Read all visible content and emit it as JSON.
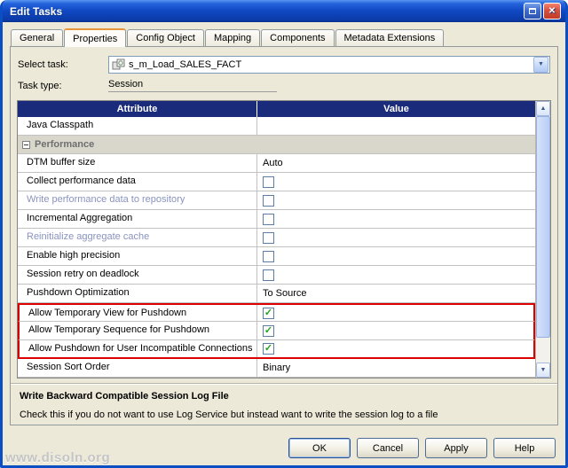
{
  "window": {
    "title": "Edit Tasks",
    "close_glyph": "✕"
  },
  "tabs": {
    "items": [
      {
        "label": "General",
        "active": false
      },
      {
        "label": "Properties",
        "active": true
      },
      {
        "label": "Config Object",
        "active": false
      },
      {
        "label": "Mapping",
        "active": false
      },
      {
        "label": "Components",
        "active": false
      },
      {
        "label": "Metadata Extensions",
        "active": false
      }
    ]
  },
  "form": {
    "select_task_label": "Select task:",
    "select_task_value": "s_m_Load_SALES_FACT",
    "task_type_label": "Task type:",
    "task_type_value": "Session"
  },
  "icons": {
    "combo_arrow": "▼",
    "scroll_up": "▲",
    "scroll_down": "▼"
  },
  "table": {
    "headers": {
      "attribute": "Attribute",
      "value": "Value"
    },
    "check_glyph": "✓",
    "rows": [
      {
        "label": "Java Classpath",
        "type": "empty"
      },
      {
        "label": "Performance",
        "type": "group"
      },
      {
        "label": "DTM buffer size",
        "type": "text",
        "value": "Auto"
      },
      {
        "label": "Collect performance data",
        "type": "checkbox",
        "checked": false
      },
      {
        "label": "Write performance data to repository",
        "type": "checkbox",
        "checked": false,
        "muted": true
      },
      {
        "label": "Incremental Aggregation",
        "type": "checkbox",
        "checked": false
      },
      {
        "label": "Reinitialize aggregate cache",
        "type": "checkbox",
        "checked": false,
        "muted": true
      },
      {
        "label": "Enable high precision",
        "type": "checkbox",
        "checked": false
      },
      {
        "label": "Session retry on deadlock",
        "type": "checkbox",
        "checked": false
      },
      {
        "label": "Pushdown Optimization",
        "type": "text",
        "value": "To Source"
      },
      {
        "label": "Allow Temporary View for Pushdown",
        "type": "checkbox",
        "checked": true,
        "highlight": "start"
      },
      {
        "label": "Allow Temporary Sequence for Pushdown",
        "type": "checkbox",
        "checked": true,
        "highlight": "mid"
      },
      {
        "label": "Allow Pushdown for User Incompatible Connections",
        "type": "checkbox",
        "checked": true,
        "highlight": "end"
      },
      {
        "label": "Session Sort Order",
        "type": "text",
        "value": "Binary"
      }
    ]
  },
  "description": {
    "title": "Write Backward Compatible Session Log File",
    "text": "Check this if you do not want to use Log Service but instead want to write the session log to a file"
  },
  "buttons": [
    {
      "label": "OK",
      "default": true
    },
    {
      "label": "Cancel",
      "default": false
    },
    {
      "label": "Apply",
      "default": false
    },
    {
      "label": "Help",
      "default": false
    }
  ],
  "colors": {
    "header_navy": "#1A2B7C",
    "highlight_red": "#DD0000",
    "muted_label": "#8A93BF",
    "check_green": "#1EA11E",
    "titlebar_blue": "#1048C2"
  },
  "watermark": "www.disoln.org"
}
